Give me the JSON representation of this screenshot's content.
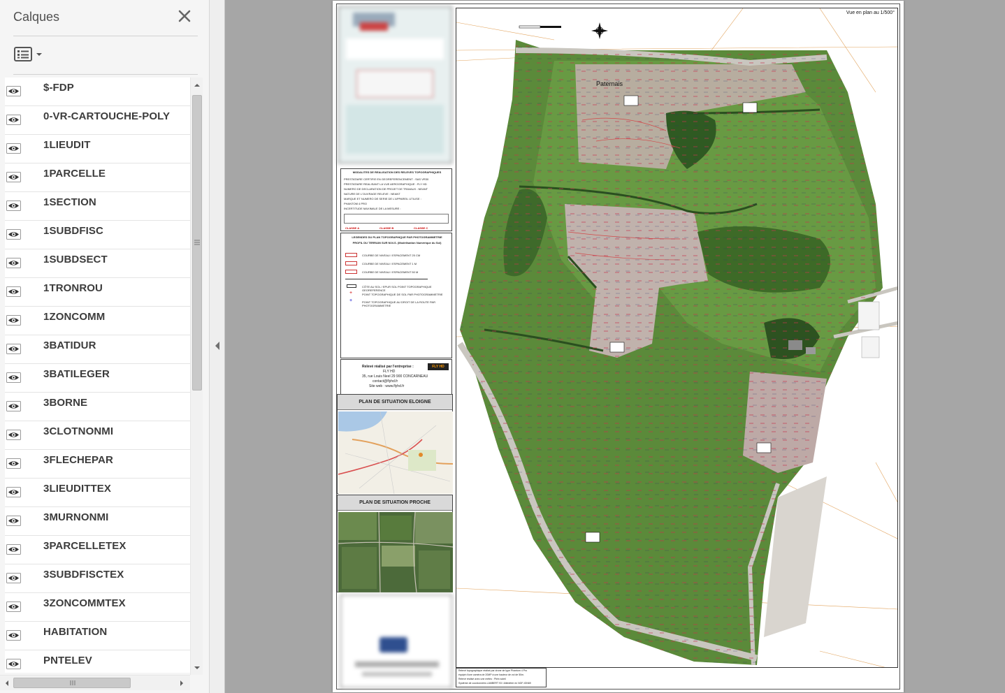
{
  "panel": {
    "title": "Calques",
    "layers": [
      "$-FDP",
      "0-VR-CARTOUCHE-POLY",
      "1LIEUDIT",
      "1PARCELLE",
      "1SECTION",
      "1SUBDFISC",
      "1SUBDSECT",
      "1TRONROU",
      "1ZONCOMM",
      "3BATIDUR",
      "3BATILEGER",
      "3BORNE",
      "3CLOTNONMI",
      "3FLECHEPAR",
      "3LIEUDITTEX",
      "3MURNONMI",
      "3PARCELLETEX",
      "3SUBDFISCTEX",
      "3ZONCOMMTEX",
      "HABITATION",
      "PNTELEV"
    ]
  },
  "document": {
    "map_caption": "Vue en plan au 1/500°",
    "place_label": "Paternais",
    "modalities": {
      "title": "MODALITES DE REALISATION DES RELEVES TOPOGRAPHIQUES",
      "lines": [
        "PRESTATAIRE CERTIFIE EN GEOREFERENCEMENT : SAS VR30",
        "PRESTATAIRE REALISANT LA VUE AEROGRAPHIQUE : FLY HD",
        "NUMERO DE DECLARATION DE PROJET DE TRAVAUX : NEANT",
        "NATURE DE L'OUVRAGE RELEVE : NEANT",
        "MARQUE ET NUMERO DE SERIE DE L'APPAREIL UTILISE :",
        "PHANTOM 4 PRO",
        "INCERTITUDE MAXIMALE DE LA MESURE :"
      ],
      "classes": [
        "CLASSE A",
        "CLASSE B",
        "CLASSE C"
      ]
    },
    "legend": {
      "title": "LEGENDES DU PLAN TOPOGRAPHIQUE PAR PHOTOGRAMMETRIE",
      "subtitle": "PROFIL DU TERRAIN SUR M.N.S. (Modélisation Numérique du Sol)",
      "items": [
        "COURBE DE NIVEAU / ESPACEMENT 25 CM",
        "COURBE DE NIVEAU / ESPACEMENT 1 M",
        "COURBE DE NIVEAU / ESPACEMENT 50 M"
      ],
      "points": [
        "CÔTE AU SOL / EPUR SOL POINT TOPOGRAPHIQUE GEOREFERENCE",
        "POINT TOPOGRAPHIQUE DE SOL PAR PHOTOGRAMMETRIE",
        "POINT TOPOGRAPHIQUE AU DROIT DE LA ROUTE PAR PHOTOGRAMMETRIE"
      ]
    },
    "company": {
      "line1": "Relevé réalisé par l'entreprise :",
      "line2": "FLY HD",
      "line3": "35, rue Louis Neel 29 900 CONCARNEAU",
      "line4": "contact@flyhd.fr",
      "line5": "Site web : www.flyhd.fr",
      "logo": "FLY HD"
    },
    "situation_far": "PLAN DE SITUATION ELOIGNE",
    "situation_near": "PLAN DE SITUATION PROCHE",
    "footer_lines": [
      "Relevé topographique réalisé par drone de type Phantom 4 Pro",
      "équipé d'une caméra de 20MP à une hauteur de vol de 50m.",
      "Relevé réalisé avec une météo : Plein soleil",
      "Système de coordonnées LAMBERT 93 / Altimétrie en NGF-IGN69"
    ]
  },
  "colors": {
    "panel_bg": "#f5f5f5",
    "viewer_bg": "#a6a6a6",
    "field_green": "#4f7d2e",
    "bare_soil": "#b9aaa1",
    "label_text": "#3c3c3c"
  }
}
